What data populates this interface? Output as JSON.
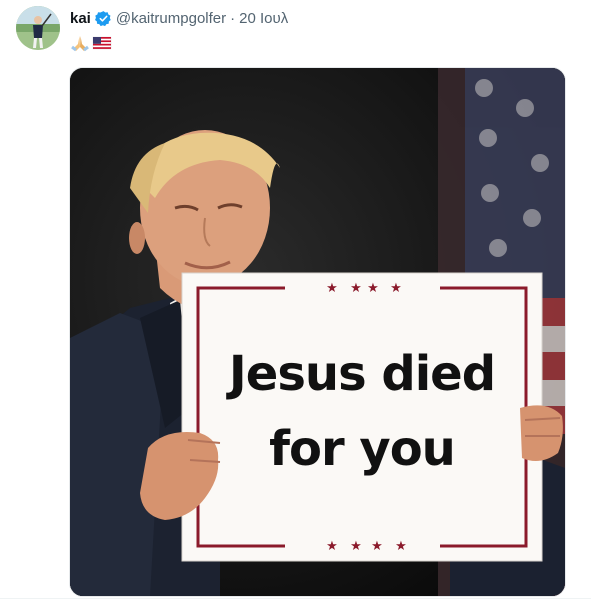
{
  "post": {
    "author": {
      "display_name": "kai",
      "verified": true,
      "handle": "@kaitrumpgolfer",
      "separator": "·",
      "timestamp": "20 Ιουλ"
    },
    "caption_emojis": [
      "folded-hands-emoji",
      "us-flag-emoji"
    ],
    "media": {
      "type": "image",
      "sign_text_lines": [
        "Jesus died",
        "for you"
      ]
    }
  },
  "colors": {
    "verified_blue": "#1d9bf0",
    "secondary_text": "#536471",
    "primary_text": "#0f1419",
    "sign_border": "#8b1a2b",
    "sign_background": "#fbf9f6"
  }
}
